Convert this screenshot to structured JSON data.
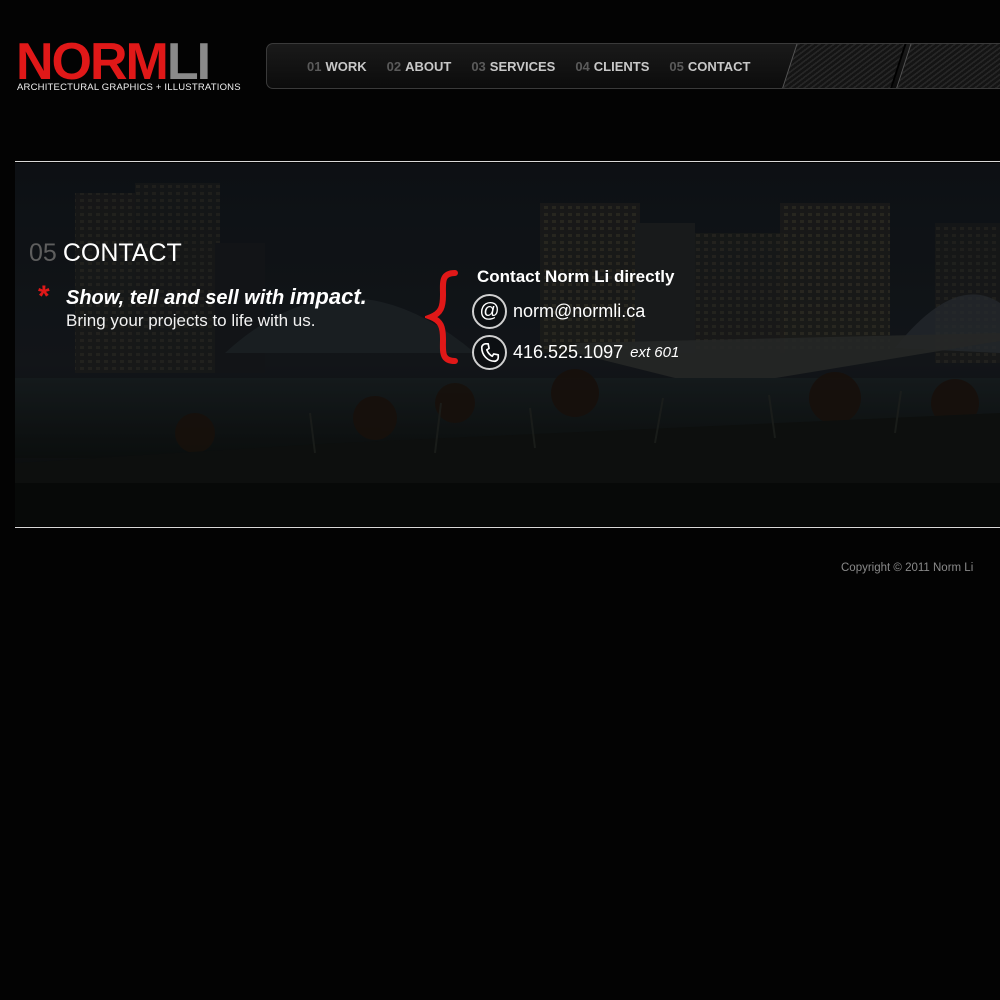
{
  "logo": {
    "norm": "NORM",
    "li": "LI",
    "tagline": "ARCHITECTURAL GRAPHICS + ILLUSTRATIONS"
  },
  "nav": {
    "items": [
      {
        "num": "01",
        "label": "WORK"
      },
      {
        "num": "02",
        "label": "ABOUT"
      },
      {
        "num": "03",
        "label": "SERVICES"
      },
      {
        "num": "04",
        "label": "CLIENTS"
      },
      {
        "num": "05",
        "label": "CONTACT"
      }
    ]
  },
  "section": {
    "num": "05",
    "title": "CONTACT",
    "tagline_start": "Show, tell and sell with ",
    "tagline_strong": "impact.",
    "subline": "Bring your projects to life with us."
  },
  "contact": {
    "heading": "Contact Norm Li directly",
    "email": "norm@normli.ca",
    "phone": "416.525.1097",
    "ext": "ext 601"
  },
  "footer": {
    "copyright": "Copyright © 2011 Norm Li"
  },
  "colors": {
    "brand_red": "#e01818",
    "background": "#030303"
  },
  "icons": {
    "email": "at-sign-icon",
    "phone": "phone-handset-icon",
    "tagline_marker": "asterisk-icon"
  }
}
